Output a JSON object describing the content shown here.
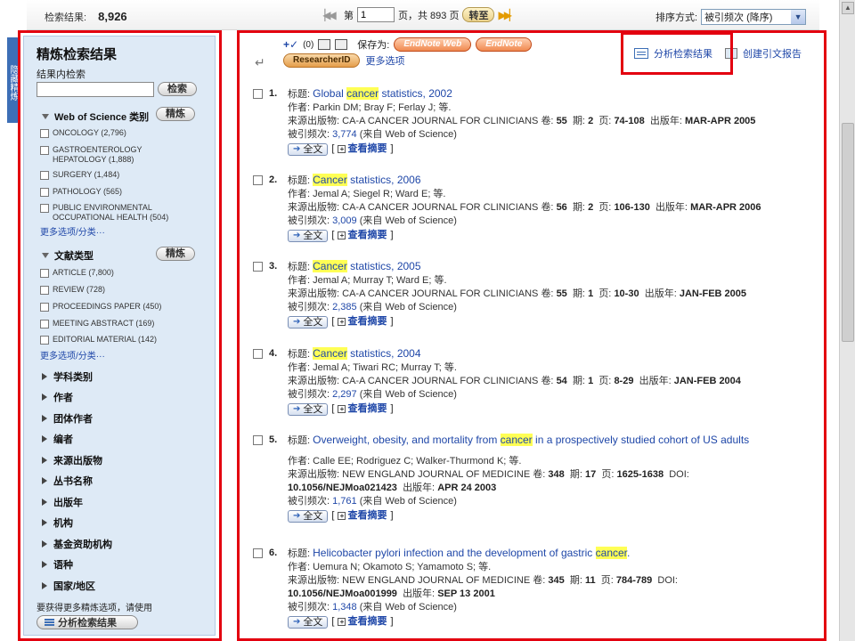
{
  "topbar": {
    "results_label": "检索结果:",
    "results_count": "8,926",
    "page_prefix": "第",
    "page_value": "1",
    "page_suffix": "页，共 893 页",
    "goto_label": "转至",
    "sort_label": "排序方式:",
    "sort_value": "被引频次 (降序)"
  },
  "sidebar": {
    "hide_tab": "隐藏精炼",
    "title": "精炼检索结果",
    "search_within_label": "结果内检索",
    "search_button": "检索",
    "wos_category": {
      "heading": "Web of Science 类别",
      "refine_button": "精炼",
      "items": [
        "ONCOLOGY (2,796)",
        "GASTROENTEROLOGY HEPATOLOGY (1,888)",
        "SURGERY (1,484)",
        "PATHOLOGY (565)",
        "PUBLIC ENVIRONMENTAL OCCUPATIONAL HEALTH (504)"
      ],
      "more": "更多选项/分类···"
    },
    "doc_type": {
      "heading": "文献类型",
      "refine_button": "精炼",
      "items": [
        "ARTICLE (7,800)",
        "REVIEW (728)",
        "PROCEEDINGS PAPER (450)",
        "MEETING ABSTRACT (169)",
        "EDITORIAL MATERIAL (142)"
      ],
      "more": "更多选项/分类···"
    },
    "collapsed_facets": [
      "学科类别",
      "作者",
      "团体作者",
      "编者",
      "来源出版物",
      "丛书名称",
      "出版年",
      "机构",
      "基金资助机构",
      "语种",
      "国家/地区"
    ],
    "footer_note": "要获得更多精炼选项，请使用",
    "analyze_button": "分析检索结果"
  },
  "toolbar": {
    "selected_count": "(0)",
    "save_to_label": "保存为:",
    "endnote_web": "EndNote Web",
    "endnote": "EndNote",
    "researcher_id": "ResearcherID",
    "more_options": "更多选项",
    "analyze_link": "分析检索结果",
    "citation_report_link": "创建引文报告"
  },
  "labels": {
    "title": "标题:",
    "author": "作者:",
    "source": "来源出版物:",
    "volume": "卷:",
    "issue": "期:",
    "pages": "页:",
    "year": "出版年:",
    "doi": "DOI:",
    "times_cited": "被引频次:",
    "from_wos_prefix": "(来自",
    "from_wos_suffix": "Web of Science)",
    "full_text": "全文",
    "view_abstract": "查看摘要",
    "bracket_open": "[",
    "bracket_close": "]"
  },
  "records": [
    {
      "num": "1.",
      "title_pre": "Global ",
      "title_hl": "cancer",
      "title_post": " statistics, 2002",
      "authors": "Parkin DM; Bray F; Ferlay J; 等.",
      "source": "CA-A CANCER JOURNAL FOR CLINICIANS",
      "volume": "55",
      "issue": "2",
      "pages": "74-108",
      "year": "MAR-APR 2005",
      "doi": "",
      "cited": "3,774"
    },
    {
      "num": "2.",
      "title_pre": "",
      "title_hl": "Cancer",
      "title_post": " statistics, 2006",
      "authors": "Jemal A; Siegel R; Ward E; 等.",
      "source": "CA-A CANCER JOURNAL FOR CLINICIANS",
      "volume": "56",
      "issue": "2",
      "pages": "106-130",
      "year": "MAR-APR 2006",
      "doi": "",
      "cited": "3,009"
    },
    {
      "num": "3.",
      "title_pre": "",
      "title_hl": "Cancer",
      "title_post": " statistics, 2005",
      "authors": "Jemal A; Murray T; Ward E; 等.",
      "source": "CA-A CANCER JOURNAL FOR CLINICIANS",
      "volume": "55",
      "issue": "1",
      "pages": "10-30",
      "year": "JAN-FEB 2005",
      "doi": "",
      "cited": "2,385"
    },
    {
      "num": "4.",
      "title_pre": "",
      "title_hl": "Cancer",
      "title_post": " statistics, 2004",
      "authors": "Jemal A; Tiwari RC; Murray T; 等.",
      "source": "CA-A CANCER JOURNAL FOR CLINICIANS",
      "volume": "54",
      "issue": "1",
      "pages": "8-29",
      "year": "JAN-FEB 2004",
      "doi": "",
      "cited": "2,297"
    },
    {
      "num": "5.",
      "title_pre": "Overweight, obesity, and mortality from ",
      "title_hl": "cancer",
      "title_post": " in a prospectively studied cohort of US adults",
      "authors": "Calle EE; Rodriguez C; Walker-Thurmond K; 等.",
      "source": "NEW ENGLAND JOURNAL OF MEDICINE",
      "volume": "348",
      "issue": "17",
      "pages": "1625-1638",
      "year": "APR 24 2003",
      "doi": "10.1056/NEJMoa021423",
      "cited": "1,761"
    },
    {
      "num": "6.",
      "title_pre": "Helicobacter pylori infection and the development of gastric ",
      "title_hl": "cancer",
      "title_post": ".",
      "authors": "Uemura N; Okamoto S; Yamamoto S; 等.",
      "source": "NEW ENGLAND JOURNAL OF MEDICINE",
      "volume": "345",
      "issue": "11",
      "pages": "784-789",
      "year": "SEP 13 2001",
      "doi": "10.1056/NEJMoa001999",
      "cited": "1,348"
    }
  ],
  "colors": {
    "highlight_frame": "#e3000f",
    "link": "#1f47a8",
    "term_highlight": "#ffff55",
    "sidebar_bg": "#deeaf6"
  }
}
